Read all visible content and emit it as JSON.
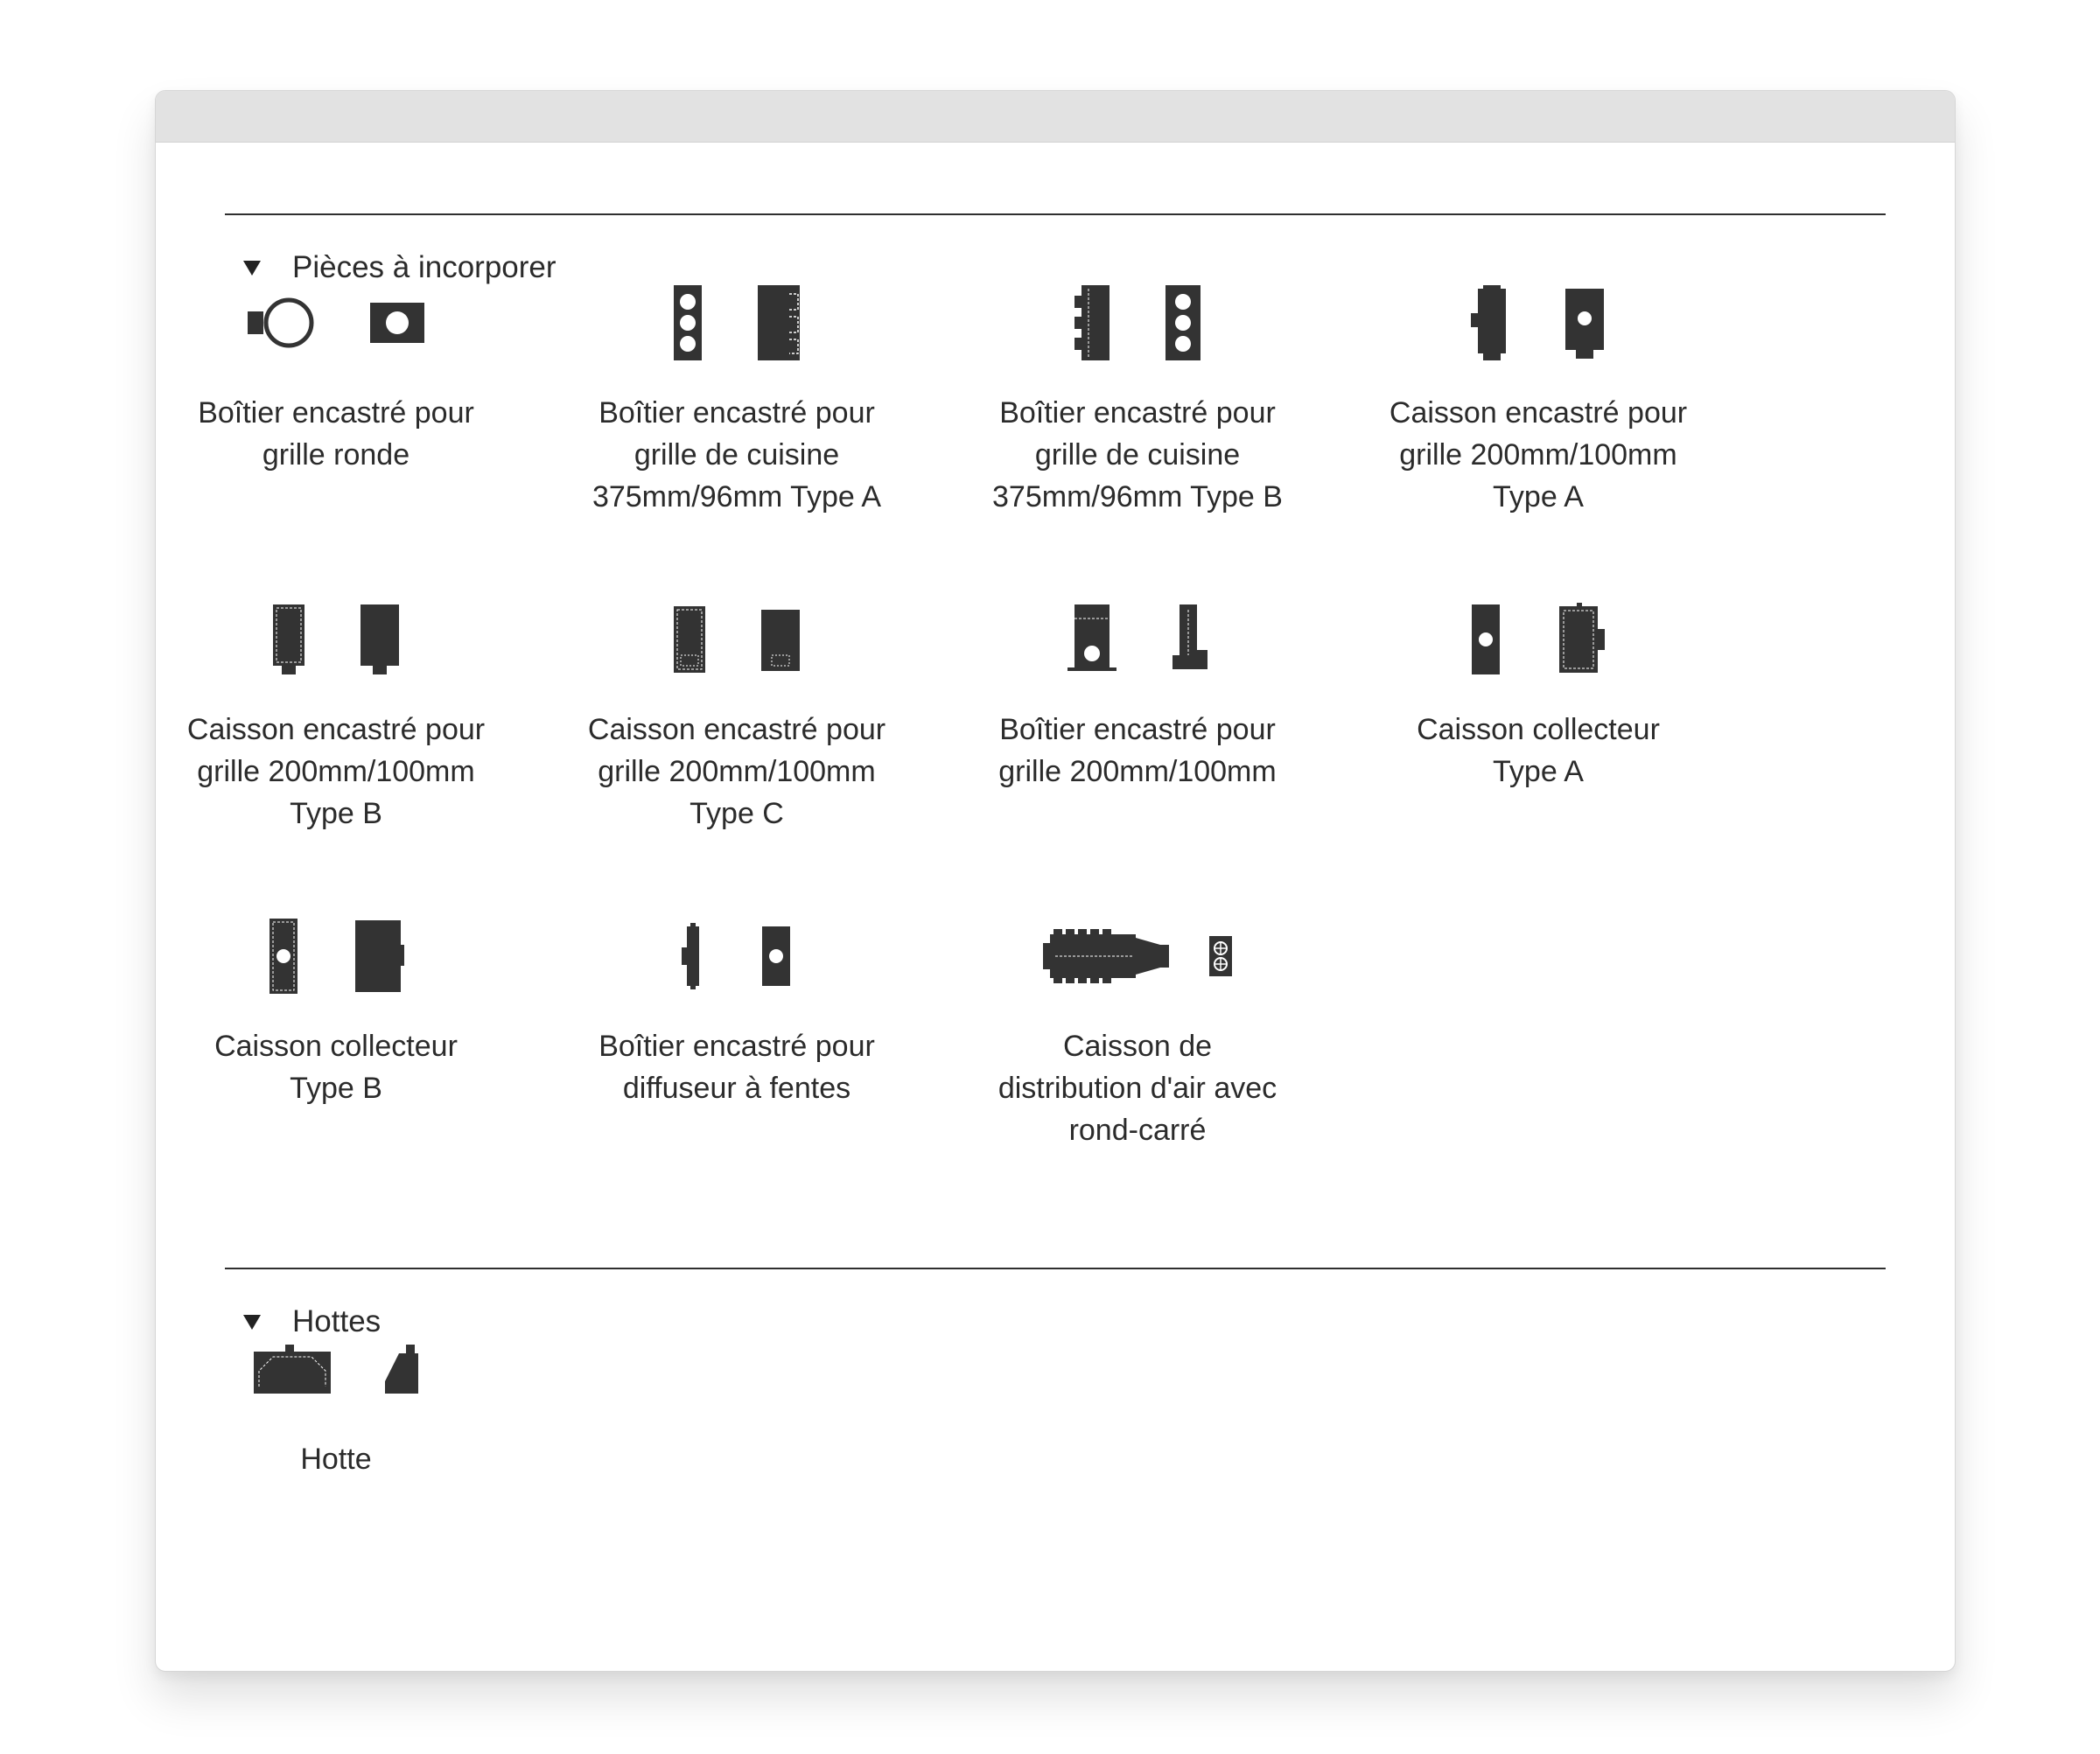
{
  "colors": {
    "icon_fill": "#333333",
    "rule": "#2f2f2f",
    "titlebar": "#e2e2e2"
  },
  "sections": [
    {
      "title": "Pièces à incorporer",
      "expanded": true,
      "items": [
        {
          "label": "Boîtier encastré pour\ngrille ronde",
          "icons": [
            "round-box-side-icon",
            "round-box-front-icon"
          ]
        },
        {
          "label": "Boîtier encastré pour\ngrille de cuisine\n375mm/96mm Type A",
          "icons": [
            "kitchen-a-front-icon",
            "kitchen-a-side-icon"
          ]
        },
        {
          "label": "Boîtier encastré pour\ngrille de cuisine\n375mm/96mm Type B",
          "icons": [
            "kitchen-b-side-icon",
            "kitchen-b-front-icon"
          ]
        },
        {
          "label": "Caisson encastré pour\ngrille 200mm/100mm\nType A",
          "icons": [
            "caisson-a-side-icon",
            "caisson-a-front-icon"
          ]
        },
        {
          "label": "Caisson encastré pour\ngrille 200mm/100mm\nType B",
          "icons": [
            "caisson-b-front-icon",
            "caisson-b-side-icon"
          ]
        },
        {
          "label": "Caisson encastré pour\ngrille 200mm/100mm\nType C",
          "icons": [
            "caisson-c-front-icon",
            "caisson-c-side-icon"
          ]
        },
        {
          "label": "Boîtier encastré pour\ngrille 200mm/100mm",
          "icons": [
            "box-200-front-icon",
            "box-200-side-icon"
          ]
        },
        {
          "label": "Caisson collecteur\nType A",
          "icons": [
            "collector-a-front-icon",
            "collector-a-side-icon"
          ]
        },
        {
          "label": "Caisson collecteur\nType B",
          "icons": [
            "collector-b-front-icon",
            "collector-b-side-icon"
          ]
        },
        {
          "label": "Boîtier encastré pour\ndiffuseur à fentes",
          "icons": [
            "slot-diffuser-side-icon",
            "slot-diffuser-front-icon"
          ]
        },
        {
          "label": "Caisson de\ndistribution d'air avec\nrond-carré",
          "icons": [
            "distribution-box-side-icon",
            "distribution-box-front-icon"
          ]
        }
      ]
    },
    {
      "title": "Hottes",
      "expanded": true,
      "items": [
        {
          "label": "Hotte",
          "icons": [
            "hood-front-icon",
            "hood-side-icon"
          ]
        }
      ]
    }
  ]
}
